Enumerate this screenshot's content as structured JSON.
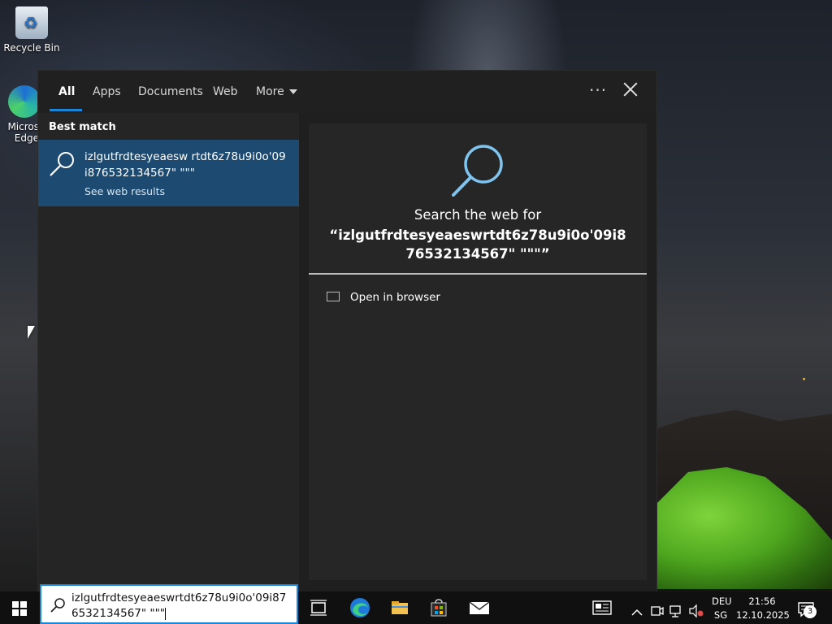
{
  "desktop": {
    "icons": [
      {
        "label": "Recycle Bin"
      },
      {
        "label": "Micros Edge"
      }
    ]
  },
  "search_panel": {
    "tabs": [
      {
        "label": "All",
        "active": true
      },
      {
        "label": "Apps"
      },
      {
        "label": "Documents"
      },
      {
        "label": "Web"
      },
      {
        "label": "More"
      }
    ],
    "options_label": "···",
    "best_match_label": "Best match",
    "result": {
      "title": "izlgutfrdtesyeaesw rtdt6z78u9i0o'09i876532134567\" \"\"\"",
      "subtitle": "See web results"
    },
    "preview": {
      "heading": "Search the web for",
      "query": "“izlgutfrdtesyeaeswrtdt6z78u9i0o'09i876532134567\" \"\"\"”",
      "action_label": "Open in browser"
    },
    "accent_color": "#1a86d9"
  },
  "taskbar": {
    "search_text": "izlgutfrdtesyeaeswrtdt6z78u9i0o'09i876532134567\" \"\"\"",
    "pinned": [
      "task-view",
      "edge",
      "file-explorer",
      "microsoft-store",
      "mail"
    ],
    "tray": {
      "language_top": "DEU",
      "language_bottom": "SG",
      "time": "21:56",
      "date": "12.10.2025",
      "notification_count": "3"
    }
  }
}
